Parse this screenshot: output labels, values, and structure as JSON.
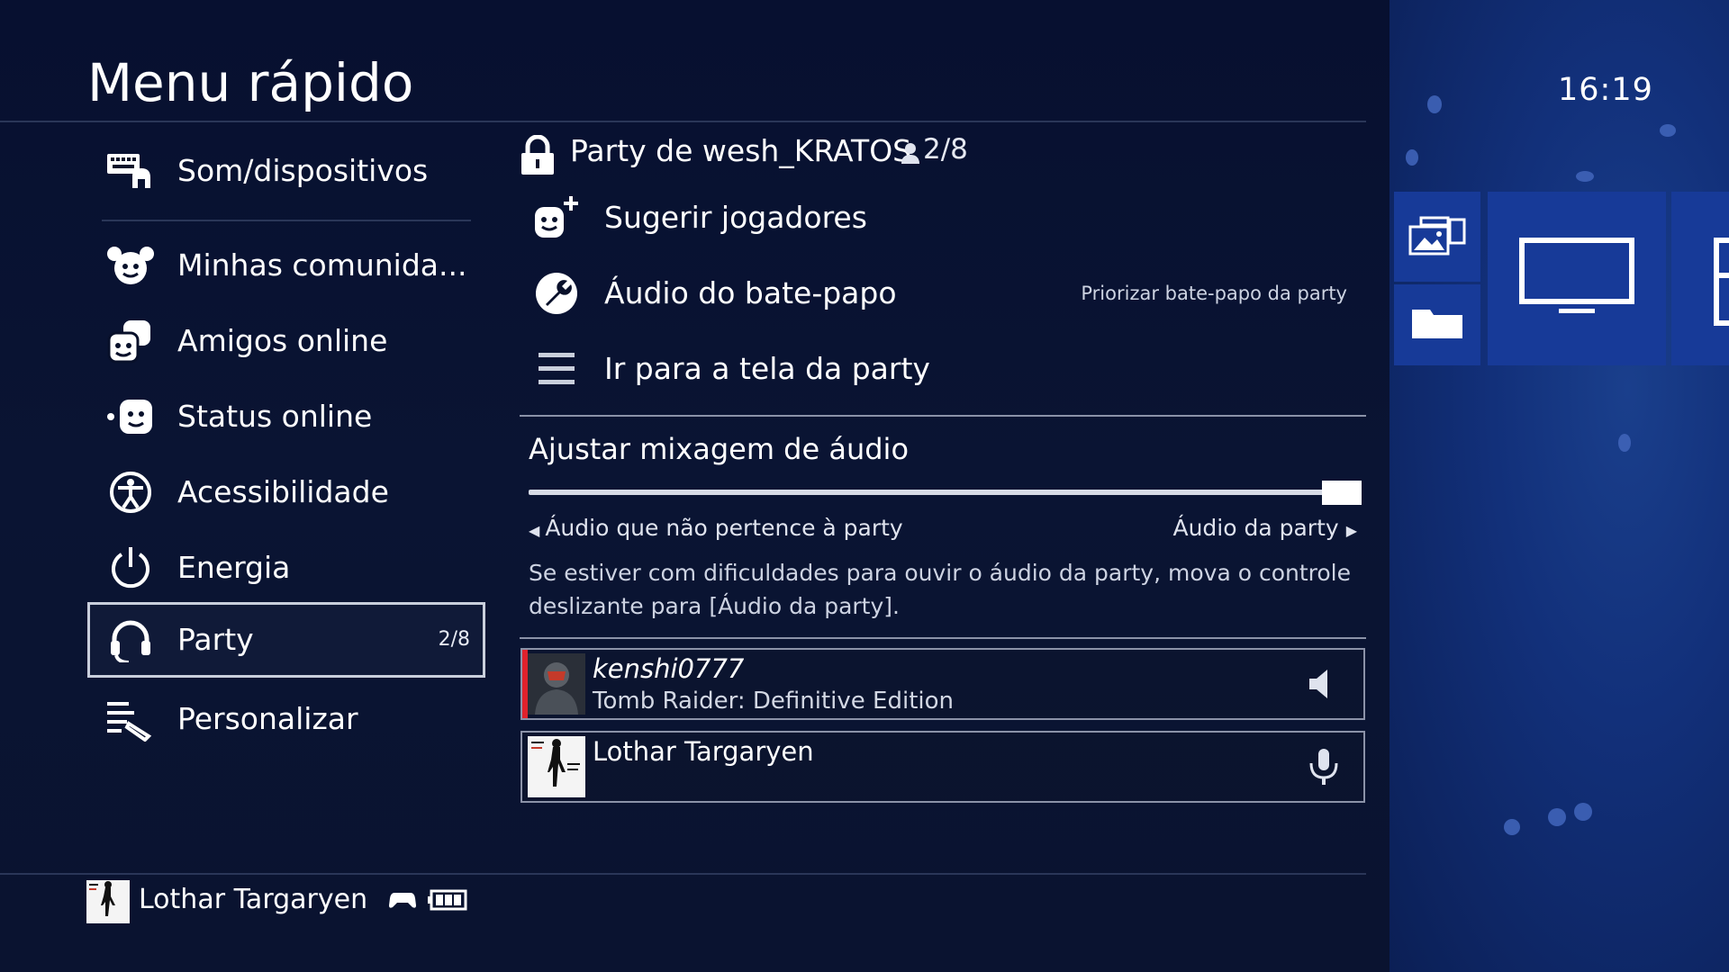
{
  "header": {
    "title": "Menu rápido"
  },
  "clock": "16:19",
  "menu": {
    "items": [
      {
        "label": "Som/dispositivos",
        "icon": "keyboard-headset-icon"
      },
      {
        "label": "Minhas comunida...",
        "icon": "communities-icon"
      },
      {
        "label": "Amigos online",
        "icon": "friends-icon"
      },
      {
        "label": "Status online",
        "icon": "status-face-icon"
      },
      {
        "label": "Acessibilidade",
        "icon": "accessibility-icon"
      },
      {
        "label": "Energia",
        "icon": "power-icon"
      },
      {
        "label": "Party",
        "icon": "headset-icon",
        "count": "2/8",
        "selected": true
      },
      {
        "label": "Personalizar",
        "icon": "customize-icon"
      }
    ]
  },
  "party": {
    "title": "Party de wesh_KRATOS",
    "members_count": "2/8",
    "options": [
      {
        "label": "Sugerir jogadores",
        "icon": "suggest-players-icon"
      },
      {
        "label": "Áudio do bate-papo",
        "icon": "wrench-icon",
        "value": "Priorizar bate-papo da party"
      },
      {
        "label": "Ir para a tela da party",
        "icon": "menu-lines-icon"
      }
    ],
    "mix": {
      "title": "Ajustar mixagem de áudio",
      "left_label": "Áudio que não pertence à party",
      "right_label": "Áudio da party",
      "level": 1.0,
      "hint": "Se estiver com dificuldades para ouvir o áudio da party, mova o controle deslizante para [Áudio da party]."
    },
    "members": [
      {
        "name": "kenshi0777",
        "game": "Tomb Raider: Definitive Edition",
        "status_icon": "speaker-icon"
      },
      {
        "name": "Lothar Targaryen",
        "game": "",
        "status_icon": "microphone-icon"
      }
    ]
  },
  "footer": {
    "user_name": "Lothar Targaryen"
  },
  "colors": {
    "panel": "#0a1433",
    "side": "#173a98",
    "accent_red": "#e0222c"
  }
}
